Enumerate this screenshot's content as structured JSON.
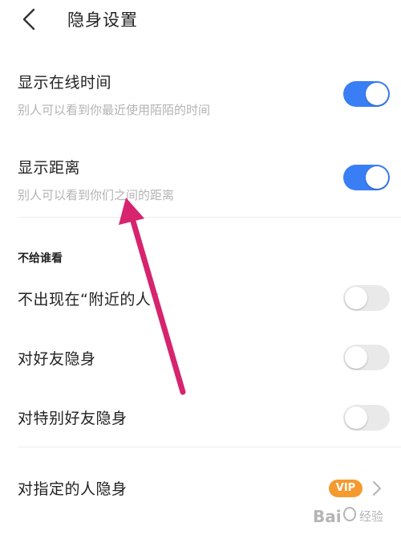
{
  "header": {
    "title": "隐身设置"
  },
  "settings": [
    {
      "title": "显示在线时间",
      "subtitle": "别人可以看到你最近使用陌陌的时间",
      "enabled": true
    },
    {
      "title": "显示距离",
      "subtitle": "别人可以看到你们之间的距离",
      "enabled": true
    }
  ],
  "section": {
    "header": "不给谁看"
  },
  "hide_from": [
    {
      "title": "不出现在“附近的人”",
      "enabled": false
    },
    {
      "title": "对好友隐身",
      "enabled": false
    },
    {
      "title": "对特别好友隐身",
      "enabled": false
    }
  ],
  "specified": {
    "title": "对指定的人隐身",
    "badge": "VIP"
  },
  "colors": {
    "accent": "#3a7ef5",
    "arrow": "#d6246e",
    "vip": "#f59a2e"
  },
  "watermark": {
    "text": "Bai 经验"
  }
}
